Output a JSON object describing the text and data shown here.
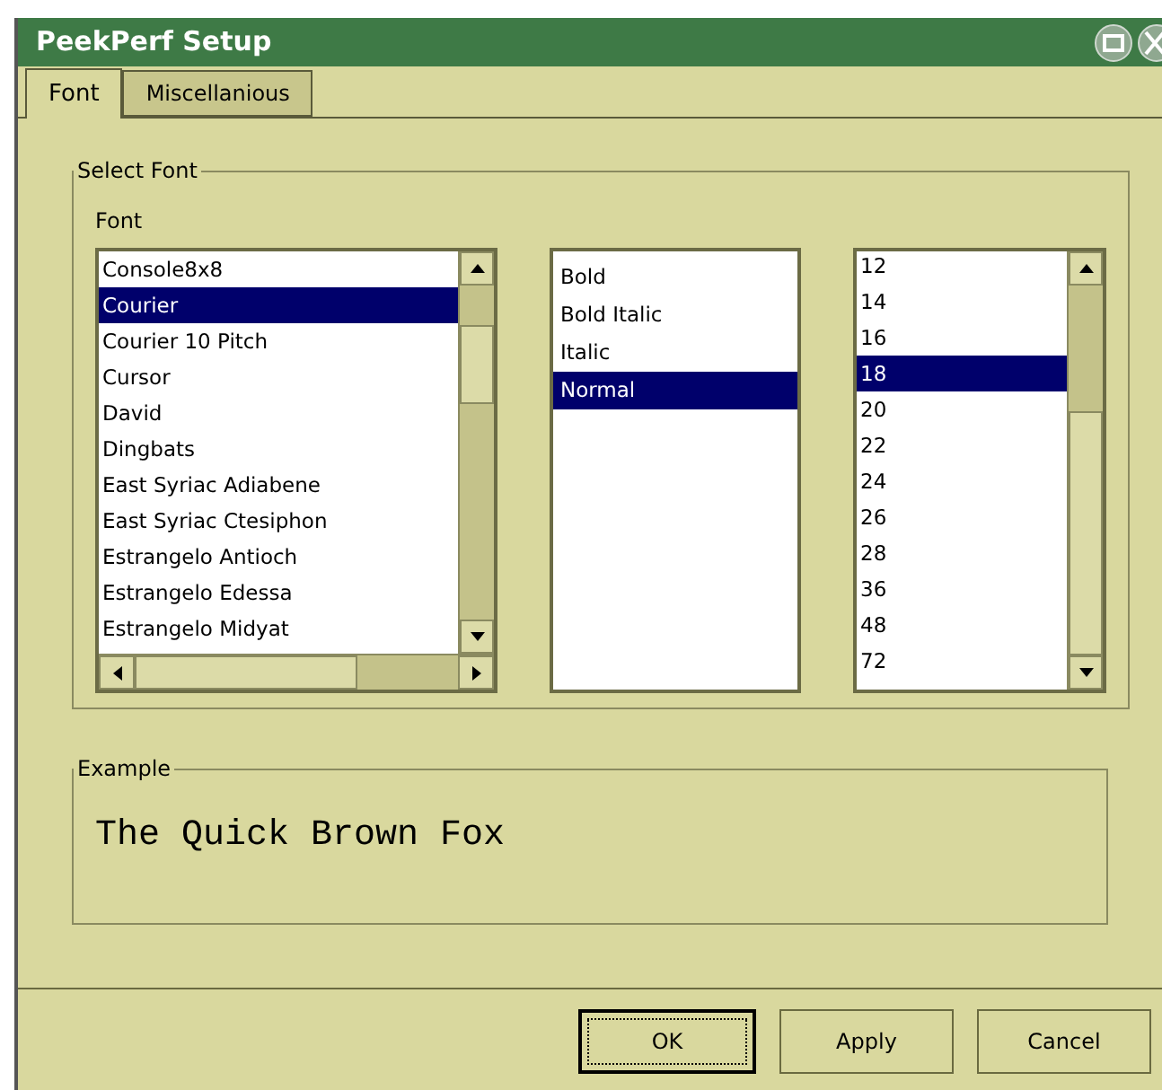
{
  "window": {
    "title": "PeekPerf Setup"
  },
  "tabs": [
    {
      "label": "Font",
      "selected": true
    },
    {
      "label": "Miscellanious",
      "selected": false
    }
  ],
  "select_font": {
    "title": "Select Font",
    "font_label": "Font",
    "fonts": [
      {
        "label": "Console8x8",
        "selected": false
      },
      {
        "label": "Courier",
        "selected": true
      },
      {
        "label": "Courier 10 Pitch",
        "selected": false
      },
      {
        "label": "Cursor",
        "selected": false
      },
      {
        "label": "David",
        "selected": false
      },
      {
        "label": "Dingbats",
        "selected": false
      },
      {
        "label": "East Syriac Adiabene",
        "selected": false
      },
      {
        "label": "East Syriac Ctesiphon",
        "selected": false
      },
      {
        "label": "Estrangelo Antioch",
        "selected": false
      },
      {
        "label": "Estrangelo Edessa",
        "selected": false
      },
      {
        "label": "Estrangelo Midyat",
        "selected": false
      }
    ],
    "styles": [
      {
        "label": "Bold",
        "selected": false
      },
      {
        "label": "Bold Italic",
        "selected": false
      },
      {
        "label": "Italic",
        "selected": false
      },
      {
        "label": "Normal",
        "selected": true
      }
    ],
    "sizes": [
      {
        "label": "12",
        "selected": false
      },
      {
        "label": "14",
        "selected": false
      },
      {
        "label": "16",
        "selected": false
      },
      {
        "label": "18",
        "selected": true
      },
      {
        "label": "20",
        "selected": false
      },
      {
        "label": "22",
        "selected": false
      },
      {
        "label": "24",
        "selected": false
      },
      {
        "label": "26",
        "selected": false
      },
      {
        "label": "28",
        "selected": false
      },
      {
        "label": "36",
        "selected": false
      },
      {
        "label": "48",
        "selected": false
      },
      {
        "label": "72",
        "selected": false
      }
    ]
  },
  "example": {
    "title": "Example",
    "text": "The Quick Brown Fox"
  },
  "buttons": [
    {
      "label": "OK",
      "default": true
    },
    {
      "label": "Apply",
      "default": false
    },
    {
      "label": "Cancel",
      "default": false
    }
  ]
}
